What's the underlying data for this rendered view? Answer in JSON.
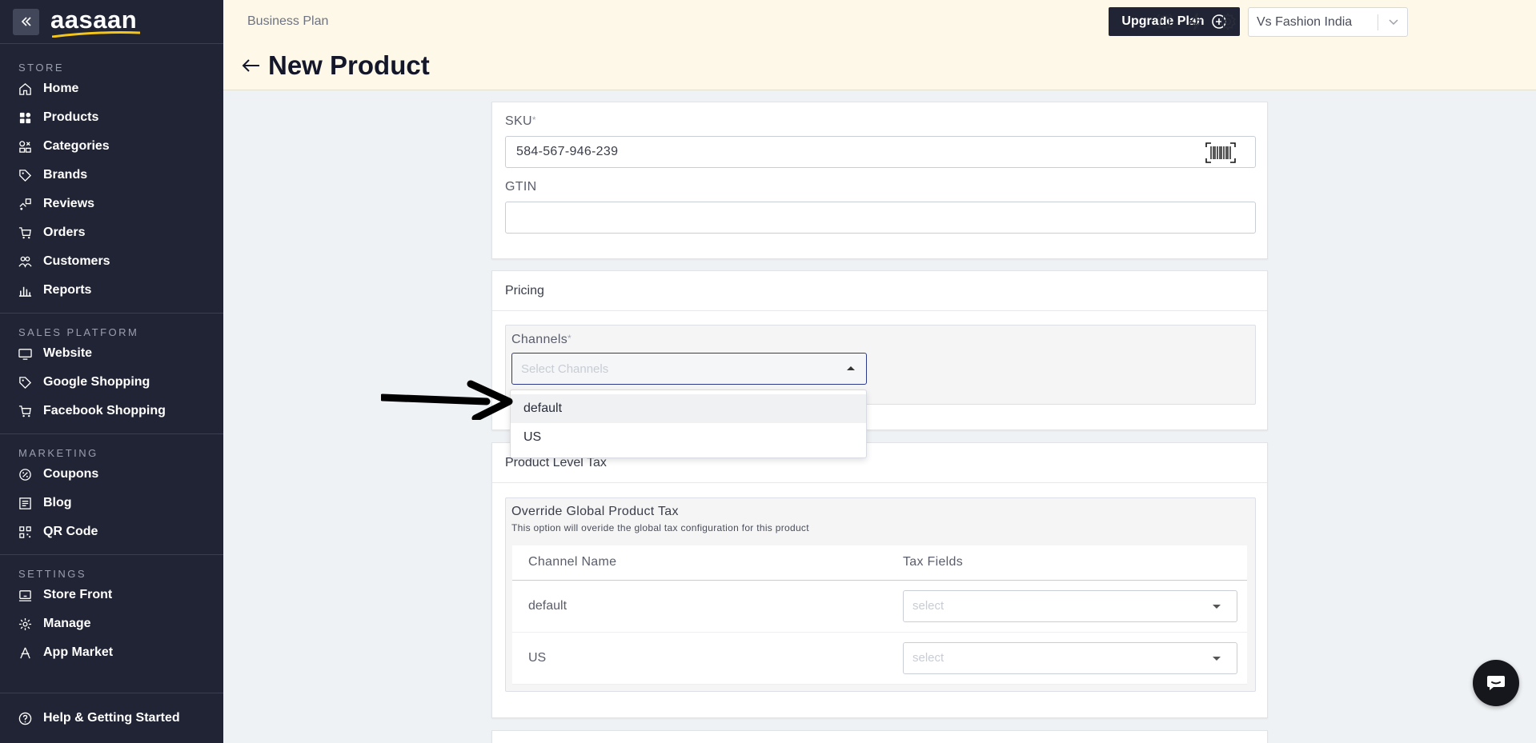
{
  "sidebar": {
    "logo": "aasaan",
    "sections": {
      "store": "STORE",
      "sales_platform": "SALES PLATFORM",
      "marketing": "MARKETING",
      "settings": "SETTINGS"
    },
    "store_items": [
      {
        "label": "Home",
        "icon": "home-icon"
      },
      {
        "label": "Products",
        "icon": "products-icon"
      },
      {
        "label": "Categories",
        "icon": "categories-icon"
      },
      {
        "label": "Brands",
        "icon": "tag-icon"
      },
      {
        "label": "Reviews",
        "icon": "reviews-icon"
      },
      {
        "label": "Orders",
        "icon": "cart-icon"
      },
      {
        "label": "Customers",
        "icon": "users-icon"
      },
      {
        "label": "Reports",
        "icon": "chart-icon"
      }
    ],
    "sales_items": [
      {
        "label": "Website",
        "icon": "monitor-icon"
      },
      {
        "label": "Google Shopping",
        "icon": "tag-icon"
      },
      {
        "label": "Facebook Shopping",
        "icon": "cart-icon"
      }
    ],
    "marketing_items": [
      {
        "label": "Coupons",
        "icon": "coupon-icon"
      },
      {
        "label": "Blog",
        "icon": "blog-icon"
      },
      {
        "label": "QR Code",
        "icon": "qr-icon"
      }
    ],
    "settings_items": [
      {
        "label": "Store Front",
        "icon": "storefront-icon"
      },
      {
        "label": "Manage",
        "icon": "gear-icon"
      },
      {
        "label": "App Market",
        "icon": "app-market-icon"
      }
    ],
    "help": "Help & Getting Started"
  },
  "header": {
    "plan": "Business Plan",
    "title": "New Product",
    "upgrade_label": "Upgrade Plan",
    "store_name": "Vs Fashion India"
  },
  "sku_card": {
    "sku_label": "SKU",
    "sku_value": "584-567-946-239",
    "gtin_label": "GTIN",
    "gtin_value": ""
  },
  "pricing": {
    "title": "Pricing",
    "channels_label": "Channels",
    "channels_placeholder": "Select Channels",
    "options": [
      "default",
      "US"
    ]
  },
  "tax": {
    "title": "Product Level Tax",
    "override_title": "Override Global Product Tax",
    "override_desc": "This option will overide the global tax configuration for this product",
    "columns": [
      "Channel Name",
      "Tax Fields"
    ],
    "rows": [
      {
        "channel": "default",
        "tax_placeholder": "select"
      },
      {
        "channel": "US",
        "tax_placeholder": "select"
      }
    ]
  },
  "colors": {
    "sidebar_bg": "#212434",
    "header_bg": "#fdf8e8",
    "accent": "#2d3a8c",
    "logo_swoosh": "#f5c518"
  },
  "required_mark": "*"
}
